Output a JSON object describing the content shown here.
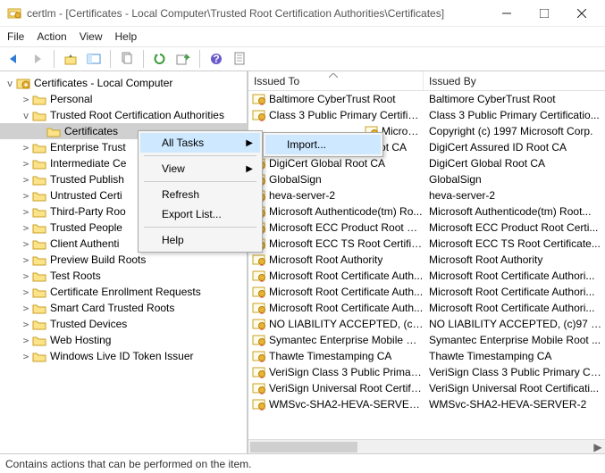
{
  "title": "certlm - [Certificates - Local Computer\\Trusted Root Certification Authorities\\Certificates]",
  "menubar": {
    "file": "File",
    "action": "Action",
    "view": "View",
    "help": "Help"
  },
  "tree": {
    "root": "Certificates - Local Computer",
    "items": [
      {
        "label": "Personal",
        "depth": 1,
        "twist": ">"
      },
      {
        "label": "Trusted Root Certification Authorities",
        "depth": 1,
        "twist": "v"
      },
      {
        "label": "Certificates",
        "depth": 2,
        "twist": "",
        "selected": true
      },
      {
        "label": "Enterprise Trust",
        "depth": 1,
        "twist": ">"
      },
      {
        "label": "Intermediate Ce",
        "depth": 1,
        "twist": ">"
      },
      {
        "label": "Trusted Publish",
        "depth": 1,
        "twist": ">"
      },
      {
        "label": "Untrusted Certi",
        "depth": 1,
        "twist": ">"
      },
      {
        "label": "Third-Party Roo",
        "depth": 1,
        "twist": ">"
      },
      {
        "label": "Trusted People",
        "depth": 1,
        "twist": ">"
      },
      {
        "label": "Client Authenti",
        "depth": 1,
        "twist": ">"
      },
      {
        "label": "Preview Build Roots",
        "depth": 1,
        "twist": ">"
      },
      {
        "label": "Test Roots",
        "depth": 1,
        "twist": ">"
      },
      {
        "label": "Certificate Enrollment Requests",
        "depth": 1,
        "twist": ">"
      },
      {
        "label": "Smart Card Trusted Roots",
        "depth": 1,
        "twist": ">"
      },
      {
        "label": "Trusted Devices",
        "depth": 1,
        "twist": ">"
      },
      {
        "label": "Web Hosting",
        "depth": 1,
        "twist": ">"
      },
      {
        "label": "Windows Live ID Token Issuer",
        "depth": 1,
        "twist": ">"
      }
    ]
  },
  "list": {
    "col1": "Issued To",
    "col2": "Issued By",
    "rows": [
      {
        "to": "Baltimore CyberTrust Root",
        "by": "Baltimore CyberTrust Root"
      },
      {
        "to": "Class 3 Public Primary Certificat...",
        "by": "Class 3 Public Primary Certificatio..."
      },
      {
        "to": "Microsoft C...",
        "by": "Copyright (c) 1997 Microsoft Corp.",
        "clip": true
      },
      {
        "to": "DigiCert Assured ID Root CA",
        "by": "DigiCert Assured ID Root CA"
      },
      {
        "to": "DigiCert Global Root CA",
        "by": "DigiCert Global Root CA"
      },
      {
        "to": "GlobalSign",
        "by": "GlobalSign"
      },
      {
        "to": "heva-server-2",
        "by": "heva-server-2"
      },
      {
        "to": "Microsoft Authenticode(tm) Ro...",
        "by": "Microsoft Authenticode(tm) Root..."
      },
      {
        "to": "Microsoft ECC Product Root Ce...",
        "by": "Microsoft ECC Product Root Certi..."
      },
      {
        "to": "Microsoft ECC TS Root Certifica...",
        "by": "Microsoft ECC TS Root Certificate..."
      },
      {
        "to": "Microsoft Root Authority",
        "by": "Microsoft Root Authority"
      },
      {
        "to": "Microsoft Root Certificate Auth...",
        "by": "Microsoft Root Certificate Authori..."
      },
      {
        "to": "Microsoft Root Certificate Auth...",
        "by": "Microsoft Root Certificate Authori..."
      },
      {
        "to": "Microsoft Root Certificate Auth...",
        "by": "Microsoft Root Certificate Authori..."
      },
      {
        "to": "NO LIABILITY ACCEPTED, (c)97 ...",
        "by": "NO LIABILITY ACCEPTED, (c)97 Ve..."
      },
      {
        "to": "Symantec Enterprise Mobile Ro...",
        "by": "Symantec Enterprise Mobile Root ..."
      },
      {
        "to": "Thawte Timestamping CA",
        "by": "Thawte Timestamping CA"
      },
      {
        "to": "VeriSign Class 3 Public Primary ...",
        "by": "VeriSign Class 3 Public Primary Ce..."
      },
      {
        "to": "VeriSign Universal Root Certific...",
        "by": "VeriSign Universal Root Certificati..."
      },
      {
        "to": "WMSvc-SHA2-HEVA-SERVER-2",
        "by": "WMSvc-SHA2-HEVA-SERVER-2"
      }
    ]
  },
  "context": {
    "all_tasks": "All Tasks",
    "view": "View",
    "refresh": "Refresh",
    "export": "Export List...",
    "help": "Help",
    "import": "Import..."
  },
  "status": "Contains actions that can be performed on the item."
}
